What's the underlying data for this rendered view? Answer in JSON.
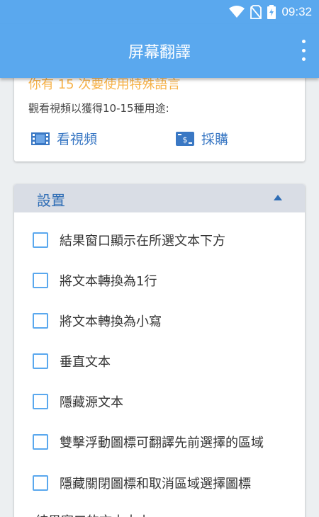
{
  "status_bar": {
    "time": "09:32"
  },
  "app_bar": {
    "title": "屏幕翻譯"
  },
  "offer_card": {
    "special_note": "你有 15 次要使用特殊語言",
    "watch_note": "觀看視頻以獲得10-15種用途:",
    "watch_label": "看視頻",
    "buy_label": "採購"
  },
  "settings": {
    "title": "設置",
    "options": [
      {
        "label": "結果窗口顯示在所選文本下方",
        "checked": false
      },
      {
        "label": "將文本轉換為1行",
        "checked": false
      },
      {
        "label": "將文本轉換為小寫",
        "checked": false
      },
      {
        "label": "垂直文本",
        "checked": false
      },
      {
        "label": "隱藏源文本",
        "checked": false
      },
      {
        "label": "雙擊浮動圖標可翻譯先前選擇的區域",
        "checked": false
      },
      {
        "label": "隱藏關閉圖標和取消區域選擇圖標",
        "checked": false
      }
    ],
    "cutoff_text": "結果窗口的文本大小"
  },
  "colors": {
    "primary": "#5aa8ee",
    "accent_text": "#3a78c4",
    "warning": "#f7b34a"
  }
}
